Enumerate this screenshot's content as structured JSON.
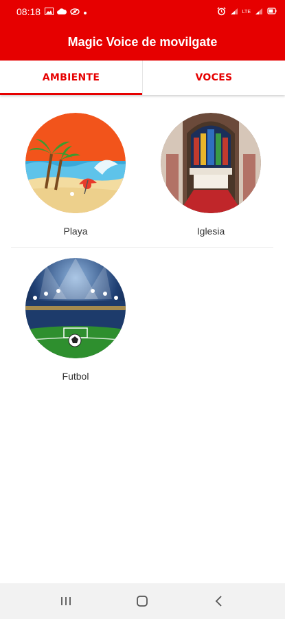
{
  "status": {
    "time": "08:18",
    "network_label": "LTE"
  },
  "app": {
    "title": "Magic Voice de movilgate",
    "brand_color": "#e60000"
  },
  "tabs": [
    {
      "label": "AMBIENTE",
      "active": true
    },
    {
      "label": "VOCES",
      "active": false
    }
  ],
  "ambients": [
    {
      "label": "Playa",
      "icon": "beach-image"
    },
    {
      "label": "Iglesia",
      "icon": "church-image"
    },
    {
      "label": "Futbol",
      "icon": "stadium-image"
    }
  ],
  "navbar": {
    "recents_icon": "recents-icon",
    "home_icon": "home-icon",
    "back_icon": "back-icon"
  }
}
